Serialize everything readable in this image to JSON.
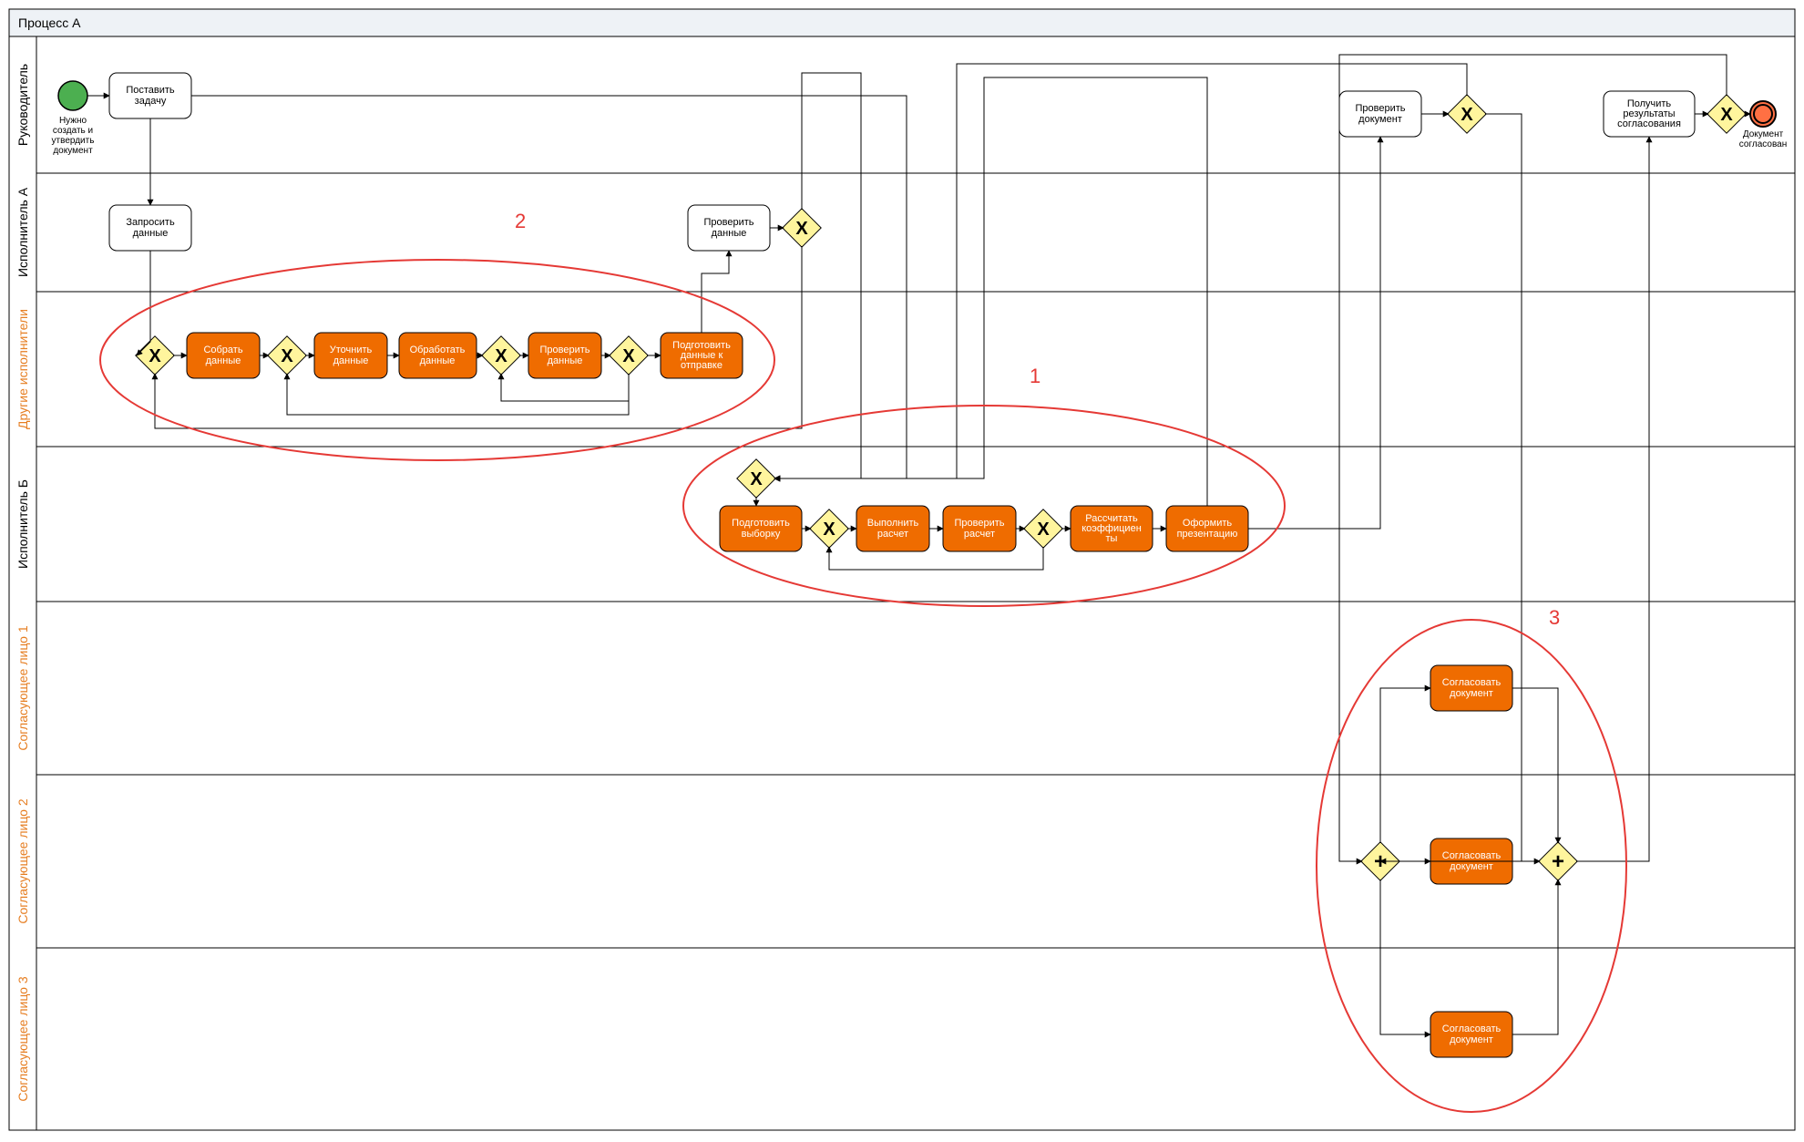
{
  "pool_title": "Процесс А",
  "lanes": {
    "l1": "Руководитель",
    "l2": "Исполнитель А",
    "l3": "Другие исполнители",
    "l4": "Исполнитель Б",
    "l5": "Согласующее лицо 1",
    "l6": "Согласующее лицо 2",
    "l7": "Согласующее лицо 3"
  },
  "events": {
    "start": "Нужно создать и утвердить документ",
    "end": "Документ согласован"
  },
  "tasks": {
    "t_set_task": "Поставить задачу",
    "t_request_data": "Запросить данные",
    "t_check_data_a": "Проверить данные",
    "t_collect": "Собрать данные",
    "t_clarify": "Уточнить данные",
    "t_process": "Обработать данные",
    "t_verify": "Проверить данные",
    "t_prepare_send": "Подготовить данные к отправке",
    "t_prepare_sample": "Подготовить выборку",
    "t_calc": "Выполнить расчет",
    "t_check_calc": "Проверить расчет",
    "t_coef": "Рассчитать коэффициенты",
    "t_present": "Оформить презентацию",
    "t_check_doc": "Проверить документ",
    "t_receive": "Получить результаты согласования",
    "t_agree1": "Согласовать документ",
    "t_agree2": "Согласовать документ",
    "t_agree3": "Согласовать документ"
  },
  "annotations": {
    "a1": "1",
    "a2": "2",
    "a3": "3"
  }
}
